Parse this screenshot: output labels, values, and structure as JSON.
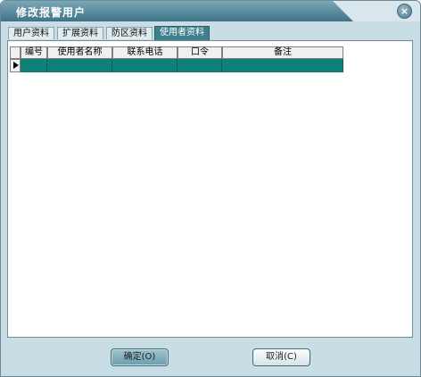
{
  "window": {
    "title": "修改报警用户",
    "close_glyph": "×"
  },
  "tabs": [
    {
      "label": "用户资料",
      "active": false
    },
    {
      "label": "扩展资料",
      "active": false
    },
    {
      "label": "防区资料",
      "active": false
    },
    {
      "label": "使用者资料",
      "active": true
    }
  ],
  "table": {
    "columns": [
      "编号",
      "使用者名称",
      "联系电话",
      "口令",
      "备注"
    ],
    "rows": [
      [
        "",
        "",
        "",
        "",
        ""
      ]
    ]
  },
  "buttons": {
    "ok": "确定(O)",
    "cancel": "取消(C)"
  },
  "colors": {
    "title_gradient": "#3f7387",
    "selected_row": "#0e8077",
    "active_tab": "#3e7f8e",
    "window_bg": "#c9dde5"
  }
}
